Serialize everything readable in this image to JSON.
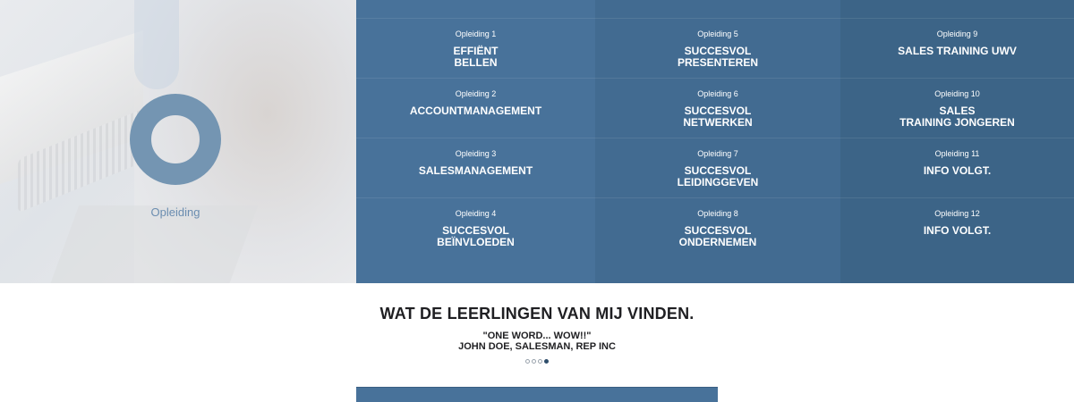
{
  "hero": {
    "label": "Opleiding",
    "ring_color": "#7495b2"
  },
  "colors": {
    "col1": "#48729a",
    "col2": "#426b91",
    "col3": "#3c6487",
    "text_dark": "#1f1f22"
  },
  "columns": [
    {
      "cells": [
        {
          "num": "Opleiding 1",
          "title": "EFFIËNT\nBELLEN"
        },
        {
          "num": "Opleiding 2",
          "title": "ACCOUNTMANAGEMENT"
        },
        {
          "num": "Opleiding 3",
          "title": "SALESMANAGEMENT"
        },
        {
          "num": "Opleiding 4",
          "title": "SUCCESVOL\nBEÏNVLOEDEN"
        }
      ]
    },
    {
      "cells": [
        {
          "num": "Opleiding 5",
          "title": "SUCCESVOL\nPRESENTEREN"
        },
        {
          "num": "Opleiding 6",
          "title": "SUCCESVOL\nNETWERKEN"
        },
        {
          "num": "Opleiding 7",
          "title": "SUCCESVOL\nLEIDINGGEVEN"
        },
        {
          "num": "Opleiding 8",
          "title": "SUCCESVOL\nONDERNEMEN"
        }
      ]
    },
    {
      "cells": [
        {
          "num": "Opleiding 9",
          "title": "SALES TRAINING UWV"
        },
        {
          "num": "Opleiding 10",
          "title": "SALES\nTRAINING JONGEREN"
        },
        {
          "num": "Opleiding 11",
          "title": "INFO VOLGT."
        },
        {
          "num": "Opleiding 12",
          "title": "INFO VOLGT."
        }
      ]
    }
  ],
  "testimonial": {
    "heading": "WAT DE LEERLINGEN VAN MIJ VINDEN.",
    "quote": "\"ONE WORD... WOW!!\"",
    "author": "JOHN DOE, SALESMAN, REP INC",
    "dots_total": 4,
    "active_dot": 4
  }
}
